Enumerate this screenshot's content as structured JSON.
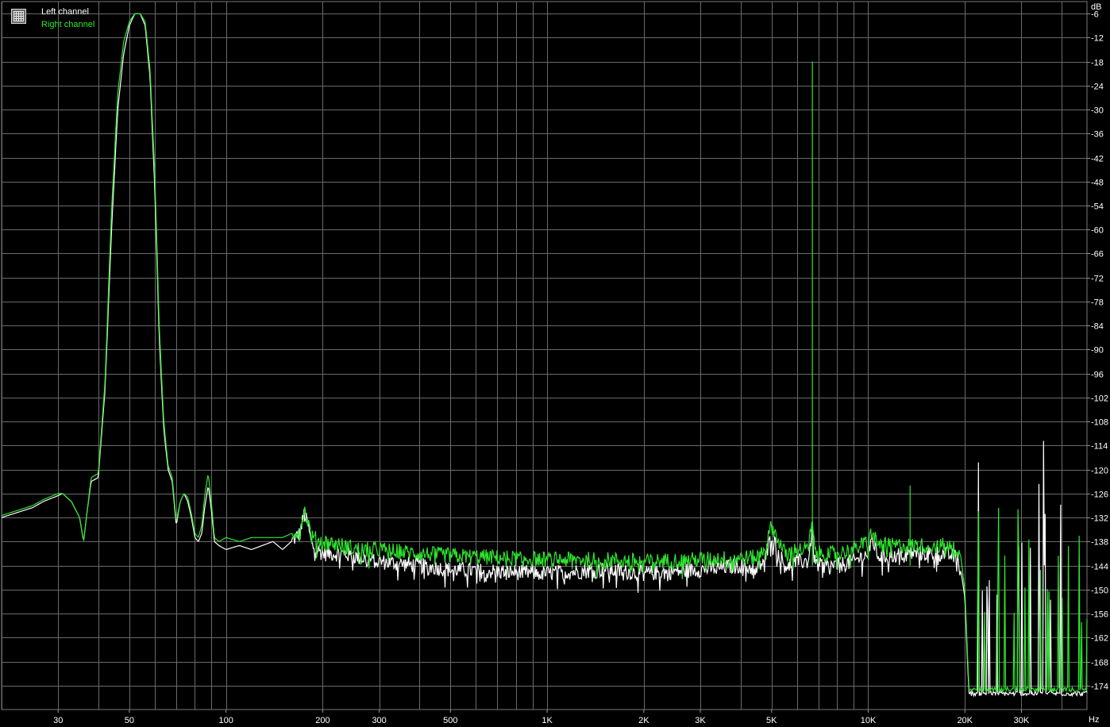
{
  "chart_data": {
    "type": "line",
    "title": "",
    "xlabel": "Hz",
    "ylabel": "dB",
    "x_scale": "log",
    "xlim": [
      20,
      48000
    ],
    "ylim": [
      -180,
      -3
    ],
    "x_ticks": [
      {
        "v": 30,
        "label": "30"
      },
      {
        "v": 50,
        "label": "50"
      },
      {
        "v": 100,
        "label": "100"
      },
      {
        "v": 200,
        "label": "200"
      },
      {
        "v": 300,
        "label": "300"
      },
      {
        "v": 500,
        "label": "500"
      },
      {
        "v": 1000,
        "label": "1K"
      },
      {
        "v": 2000,
        "label": "2K"
      },
      {
        "v": 3000,
        "label": "3K"
      },
      {
        "v": 5000,
        "label": "5K"
      },
      {
        "v": 10000,
        "label": "10K"
      },
      {
        "v": 20000,
        "label": "20K"
      },
      {
        "v": 30000,
        "label": "30K"
      }
    ],
    "x_grid": [
      20,
      30,
      40,
      50,
      60,
      70,
      80,
      90,
      100,
      200,
      300,
      400,
      500,
      600,
      700,
      800,
      900,
      1000,
      2000,
      3000,
      4000,
      5000,
      6000,
      7000,
      8000,
      9000,
      10000,
      20000,
      30000,
      40000
    ],
    "y_ticks": [
      -6,
      -12,
      -18,
      -24,
      -30,
      -36,
      -42,
      -48,
      -54,
      -60,
      -66,
      -72,
      -78,
      -84,
      -90,
      -96,
      -102,
      -108,
      -114,
      -120,
      -126,
      -132,
      -138,
      -144,
      -150,
      -156,
      -162,
      -168,
      -174
    ],
    "grid": true,
    "legend_position": "top-left",
    "series": [
      {
        "name": "Left channel",
        "color": "#ffffff",
        "points": [
          [
            20,
            -132
          ],
          [
            25,
            -129.5
          ],
          [
            27,
            -128
          ],
          [
            30,
            -126.5
          ],
          [
            31,
            -126
          ],
          [
            33,
            -128
          ],
          [
            35,
            -132
          ],
          [
            36,
            -138
          ],
          [
            37,
            -130
          ],
          [
            38,
            -123
          ],
          [
            40,
            -122
          ],
          [
            42,
            -100
          ],
          [
            44,
            -60
          ],
          [
            46,
            -30
          ],
          [
            48,
            -16
          ],
          [
            50,
            -9
          ],
          [
            52,
            -6
          ],
          [
            54,
            -6
          ],
          [
            56,
            -9
          ],
          [
            58,
            -22
          ],
          [
            60,
            -50
          ],
          [
            62,
            -88
          ],
          [
            64,
            -110
          ],
          [
            66,
            -120
          ],
          [
            68,
            -123
          ],
          [
            70,
            -134
          ],
          [
            72,
            -128
          ],
          [
            74,
            -126
          ],
          [
            76,
            -128
          ],
          [
            78,
            -132
          ],
          [
            80,
            -137
          ],
          [
            82,
            -138
          ],
          [
            84,
            -136
          ],
          [
            86,
            -129
          ],
          [
            88,
            -124
          ],
          [
            90,
            -130
          ],
          [
            92,
            -138
          ],
          [
            95,
            -139
          ],
          [
            100,
            -140
          ],
          [
            110,
            -139
          ],
          [
            120,
            -140
          ],
          [
            140,
            -138
          ],
          [
            150,
            -140
          ],
          [
            170,
            -136
          ],
          [
            175,
            -131
          ],
          [
            180,
            -134
          ],
          [
            185,
            -139
          ],
          [
            200,
            -141
          ],
          [
            230,
            -141
          ],
          [
            260,
            -142
          ],
          [
            300,
            -143
          ],
          [
            400,
            -144
          ],
          [
            500,
            -145
          ],
          [
            700,
            -145.5
          ],
          [
            1000,
            -146
          ],
          [
            1500,
            -145
          ],
          [
            2000,
            -146
          ],
          [
            3000,
            -145
          ],
          [
            4000,
            -144
          ],
          [
            4500,
            -145
          ],
          [
            4800,
            -142
          ],
          [
            5000,
            -136
          ],
          [
            5200,
            -140
          ],
          [
            5500,
            -144
          ],
          [
            6000,
            -143
          ],
          [
            6500,
            -143
          ],
          [
            6700,
            -135
          ],
          [
            6800,
            -143
          ],
          [
            7000,
            -144
          ],
          [
            8000,
            -144
          ],
          [
            9000,
            -143
          ],
          [
            10000,
            -141
          ],
          [
            10300,
            -137
          ],
          [
            10600,
            -141
          ],
          [
            11000,
            -142
          ],
          [
            13000,
            -141
          ],
          [
            15000,
            -141
          ],
          [
            17000,
            -141
          ],
          [
            19000,
            -142
          ],
          [
            19500,
            -146
          ],
          [
            20000,
            -152
          ],
          [
            20300,
            -165
          ],
          [
            20600,
            -176
          ],
          [
            25000,
            -176
          ],
          [
            30000,
            -176
          ],
          [
            35000,
            -176
          ],
          [
            40000,
            -176
          ],
          [
            47000,
            -176
          ]
        ]
      },
      {
        "name": "Right channel",
        "color": "#2ee62e",
        "points": [
          [
            20,
            -131.5
          ],
          [
            25,
            -129
          ],
          [
            27,
            -127.5
          ],
          [
            30,
            -126
          ],
          [
            31,
            -126
          ],
          [
            33,
            -128
          ],
          [
            35,
            -132
          ],
          [
            36,
            -138
          ],
          [
            37,
            -130
          ],
          [
            38,
            -122
          ],
          [
            40,
            -121
          ],
          [
            42,
            -98
          ],
          [
            44,
            -55
          ],
          [
            46,
            -26
          ],
          [
            48,
            -13
          ],
          [
            50,
            -8
          ],
          [
            52,
            -6
          ],
          [
            54,
            -6
          ],
          [
            56,
            -8
          ],
          [
            58,
            -20
          ],
          [
            60,
            -46
          ],
          [
            62,
            -85
          ],
          [
            64,
            -108
          ],
          [
            66,
            -119
          ],
          [
            68,
            -122
          ],
          [
            70,
            -133
          ],
          [
            72,
            -128
          ],
          [
            74,
            -126
          ],
          [
            76,
            -127
          ],
          [
            78,
            -131
          ],
          [
            80,
            -136
          ],
          [
            82,
            -137
          ],
          [
            84,
            -134
          ],
          [
            86,
            -126
          ],
          [
            88,
            -121
          ],
          [
            90,
            -128
          ],
          [
            92,
            -137
          ],
          [
            95,
            -138
          ],
          [
            100,
            -137
          ],
          [
            110,
            -138
          ],
          [
            120,
            -137
          ],
          [
            140,
            -137
          ],
          [
            150,
            -137
          ],
          [
            170,
            -135
          ],
          [
            175,
            -130
          ],
          [
            180,
            -133
          ],
          [
            185,
            -137
          ],
          [
            200,
            -138
          ],
          [
            230,
            -139
          ],
          [
            260,
            -140
          ],
          [
            300,
            -140
          ],
          [
            400,
            -141
          ],
          [
            500,
            -141.5
          ],
          [
            700,
            -142
          ],
          [
            1000,
            -142.5
          ],
          [
            1500,
            -142.5
          ],
          [
            2000,
            -143
          ],
          [
            3000,
            -142.5
          ],
          [
            4000,
            -142
          ],
          [
            4500,
            -142
          ],
          [
            4800,
            -139
          ],
          [
            5000,
            -134
          ],
          [
            5200,
            -137
          ],
          [
            5500,
            -141
          ],
          [
            6000,
            -140
          ],
          [
            6500,
            -140
          ],
          [
            6700,
            -133
          ],
          [
            6800,
            -140
          ],
          [
            7000,
            -141
          ],
          [
            8000,
            -141
          ],
          [
            9000,
            -140
          ],
          [
            10000,
            -138
          ],
          [
            10300,
            -135
          ],
          [
            10600,
            -138
          ],
          [
            11000,
            -139
          ],
          [
            13000,
            -139
          ],
          [
            15000,
            -139
          ],
          [
            17000,
            -139
          ],
          [
            19000,
            -140
          ],
          [
            19500,
            -143
          ],
          [
            20000,
            -150
          ],
          [
            20300,
            -163
          ],
          [
            20600,
            -175
          ],
          [
            25000,
            -175
          ],
          [
            30000,
            -175
          ],
          [
            35000,
            -175
          ],
          [
            40000,
            -175
          ],
          [
            47000,
            -175
          ]
        ],
        "spikes": [
          [
            6700,
            -18
          ],
          [
            13500,
            -124
          ]
        ]
      }
    ]
  },
  "legend": {
    "left_label": "Left channel",
    "right_label": "Right channel",
    "icon": "grid-icon"
  },
  "axis_units": {
    "x": "Hz",
    "y": "dB"
  }
}
